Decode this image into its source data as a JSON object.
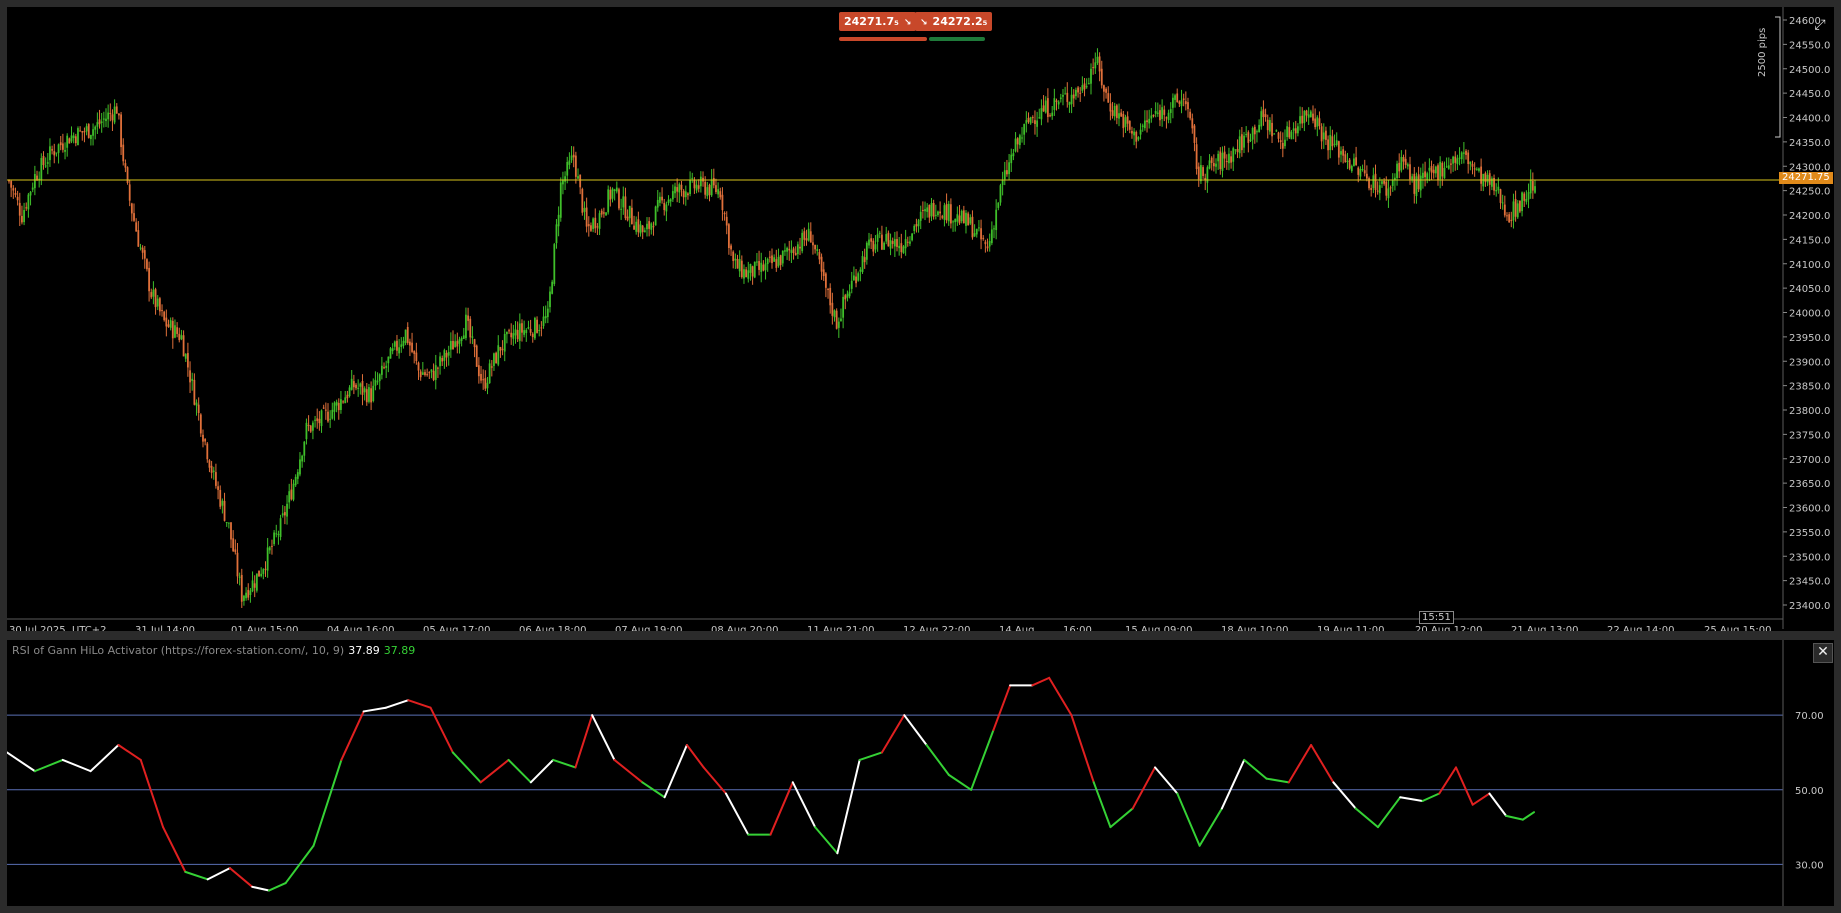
{
  "colors": {
    "bull": "#3fbf2a",
    "bear": "#e0703a",
    "price_line": "#d9c51c",
    "level_line": "#5a6fb5",
    "rsi_up": "#35d135",
    "rsi_down": "#e02020",
    "rsi_neutral": "#ffffff"
  },
  "quotes": {
    "bid": "24271.7₅",
    "ask": "24272.2₅",
    "bid_arrow": "↘",
    "ask_arrow": "↘"
  },
  "price_axis": {
    "current_price_label": "24271.75",
    "range_label": "2500 pips",
    "ticks": [
      "24600",
      "24550.0",
      "24500.0",
      "24450.0",
      "24400.0",
      "24350.0",
      "24300.0",
      "24250.0",
      "24200.0",
      "24150.0",
      "24100.0",
      "24050.0",
      "24000.0",
      "23950.0",
      "23900.0",
      "23850.0",
      "23800.0",
      "23750.0",
      "23700.0",
      "23650.0",
      "23600.0",
      "23550.0",
      "23500.0",
      "23450.0",
      "23400.0"
    ]
  },
  "time_axis": {
    "labels": [
      "30 Jul 2025, UTC+2",
      "31 Jul 14:00",
      "01 Aug 15:00",
      "04 Aug 16:00",
      "05 Aug 17:00",
      "06 Aug 18:00",
      "07 Aug 19:00",
      "08 Aug 20:00",
      "11 Aug 21:00",
      "12 Aug 22:00",
      "14 Aug",
      "16:00",
      "15 Aug 09:00",
      "18 Aug 10:00",
      "19 Aug 11:00",
      "20 Aug 12:00",
      "21 Aug 13:00",
      "22 Aug 14:00",
      "25 Aug 15:00"
    ],
    "cursor_time": "15:51"
  },
  "indicator": {
    "title": "RSI of Gann HiLo Activator (https://forex-station.com/, 10, 9)",
    "value_neutral": "37.89",
    "value_colored": "37.89",
    "levels": [
      {
        "label": "70.00",
        "value": 70
      },
      {
        "label": "50.00",
        "value": 50
      },
      {
        "label": "30.00",
        "value": 30
      }
    ],
    "range": [
      21,
      88
    ]
  },
  "chart_data": {
    "type": "candlestick",
    "price_range": [
      23380,
      24610
    ],
    "current_price": 24271.75,
    "close_path": [
      [
        0,
        24270
      ],
      [
        6,
        24200
      ],
      [
        12,
        24280
      ],
      [
        20,
        24330
      ],
      [
        28,
        24360
      ],
      [
        40,
        24380
      ],
      [
        50,
        24420
      ],
      [
        55,
        24250
      ],
      [
        60,
        24150
      ],
      [
        66,
        24040
      ],
      [
        72,
        23980
      ],
      [
        80,
        23950
      ],
      [
        88,
        23790
      ],
      [
        95,
        23660
      ],
      [
        102,
        23560
      ],
      [
        108,
        23420
      ],
      [
        114,
        23450
      ],
      [
        120,
        23500
      ],
      [
        126,
        23560
      ],
      [
        132,
        23650
      ],
      [
        138,
        23760
      ],
      [
        145,
        23780
      ],
      [
        152,
        23810
      ],
      [
        160,
        23850
      ],
      [
        168,
        23830
      ],
      [
        176,
        23900
      ],
      [
        184,
        23960
      ],
      [
        190,
        23880
      ],
      [
        196,
        23870
      ],
      [
        204,
        23920
      ],
      [
        212,
        23980
      ],
      [
        220,
        23850
      ],
      [
        228,
        23930
      ],
      [
        236,
        23960
      ],
      [
        244,
        23970
      ],
      [
        250,
        23990
      ],
      [
        256,
        24260
      ],
      [
        262,
        24320
      ],
      [
        268,
        24170
      ],
      [
        274,
        24200
      ],
      [
        280,
        24250
      ],
      [
        288,
        24200
      ],
      [
        295,
        24160
      ],
      [
        302,
        24220
      ],
      [
        310,
        24250
      ],
      [
        320,
        24260
      ],
      [
        330,
        24250
      ],
      [
        336,
        24100
      ],
      [
        342,
        24080
      ],
      [
        350,
        24090
      ],
      [
        358,
        24110
      ],
      [
        366,
        24140
      ],
      [
        372,
        24160
      ],
      [
        378,
        24060
      ],
      [
        384,
        23980
      ],
      [
        390,
        24050
      ],
      [
        398,
        24130
      ],
      [
        406,
        24150
      ],
      [
        414,
        24140
      ],
      [
        422,
        24190
      ],
      [
        430,
        24220
      ],
      [
        438,
        24200
      ],
      [
        446,
        24180
      ],
      [
        454,
        24130
      ],
      [
        460,
        24250
      ],
      [
        466,
        24330
      ],
      [
        474,
        24400
      ],
      [
        482,
        24420
      ],
      [
        490,
        24440
      ],
      [
        498,
        24460
      ],
      [
        504,
        24520
      ],
      [
        510,
        24430
      ],
      [
        516,
        24400
      ],
      [
        522,
        24360
      ],
      [
        530,
        24400
      ],
      [
        538,
        24420
      ],
      [
        546,
        24440
      ],
      [
        552,
        24280
      ],
      [
        558,
        24300
      ],
      [
        566,
        24320
      ],
      [
        574,
        24360
      ],
      [
        582,
        24400
      ],
      [
        590,
        24350
      ],
      [
        598,
        24390
      ],
      [
        604,
        24420
      ],
      [
        610,
        24360
      ],
      [
        618,
        24330
      ],
      [
        626,
        24290
      ],
      [
        632,
        24270
      ],
      [
        640,
        24250
      ],
      [
        646,
        24320
      ],
      [
        652,
        24260
      ],
      [
        660,
        24280
      ],
      [
        668,
        24310
      ],
      [
        676,
        24320
      ],
      [
        682,
        24280
      ],
      [
        690,
        24250
      ],
      [
        696,
        24200
      ],
      [
        702,
        24230
      ],
      [
        708,
        24271
      ]
    ],
    "rsi_path": [
      [
        0,
        60,
        "n"
      ],
      [
        10,
        55,
        "n"
      ],
      [
        20,
        58,
        "u"
      ],
      [
        30,
        55,
        "n"
      ],
      [
        40,
        62,
        "n"
      ],
      [
        48,
        58,
        "d"
      ],
      [
        56,
        40,
        "d"
      ],
      [
        64,
        28,
        "d"
      ],
      [
        72,
        26,
        "u"
      ],
      [
        80,
        29,
        "n"
      ],
      [
        88,
        24,
        "d"
      ],
      [
        94,
        23,
        "n"
      ],
      [
        100,
        25,
        "u"
      ],
      [
        110,
        35,
        "u"
      ],
      [
        120,
        58,
        "u"
      ],
      [
        128,
        71,
        "d"
      ],
      [
        136,
        72,
        "n"
      ],
      [
        144,
        74,
        "n"
      ],
      [
        152,
        72,
        "d"
      ],
      [
        160,
        60,
        "d"
      ],
      [
        170,
        52,
        "u"
      ],
      [
        180,
        58,
        "d"
      ],
      [
        188,
        52,
        "u"
      ],
      [
        196,
        58,
        "n"
      ],
      [
        204,
        56,
        "u"
      ],
      [
        210,
        70,
        "d"
      ],
      [
        218,
        58,
        "n"
      ],
      [
        228,
        52,
        "d"
      ],
      [
        236,
        48,
        "u"
      ],
      [
        244,
        62,
        "n"
      ],
      [
        250,
        56,
        "d"
      ],
      [
        258,
        49,
        "d"
      ],
      [
        266,
        38,
        "n"
      ],
      [
        274,
        38,
        "u"
      ],
      [
        282,
        52,
        "d"
      ],
      [
        290,
        40,
        "n"
      ],
      [
        298,
        33,
        "u"
      ],
      [
        306,
        58,
        "n"
      ],
      [
        314,
        60,
        "u"
      ],
      [
        322,
        70,
        "d"
      ],
      [
        330,
        62,
        "n"
      ],
      [
        338,
        54,
        "u"
      ],
      [
        346,
        50,
        "u"
      ],
      [
        354,
        66,
        "u"
      ],
      [
        360,
        78,
        "d"
      ],
      [
        368,
        78,
        "n"
      ],
      [
        374,
        80,
        "d"
      ],
      [
        382,
        70,
        "d"
      ],
      [
        390,
        52,
        "d"
      ],
      [
        396,
        40,
        "u"
      ],
      [
        404,
        45,
        "u"
      ],
      [
        412,
        56,
        "d"
      ],
      [
        420,
        49,
        "n"
      ],
      [
        428,
        35,
        "u"
      ],
      [
        436,
        45,
        "u"
      ],
      [
        444,
        58,
        "n"
      ],
      [
        452,
        53,
        "u"
      ],
      [
        460,
        52,
        "u"
      ],
      [
        468,
        62,
        "d"
      ],
      [
        476,
        52,
        "d"
      ],
      [
        484,
        45,
        "n"
      ],
      [
        492,
        40,
        "u"
      ],
      [
        500,
        48,
        "u"
      ],
      [
        508,
        47,
        "n"
      ],
      [
        514,
        49,
        "u"
      ],
      [
        520,
        56,
        "d"
      ],
      [
        526,
        46,
        "d"
      ],
      [
        532,
        49,
        "d"
      ],
      [
        538,
        43,
        "n"
      ],
      [
        544,
        42,
        "u"
      ],
      [
        548,
        44,
        "u"
      ]
    ]
  }
}
